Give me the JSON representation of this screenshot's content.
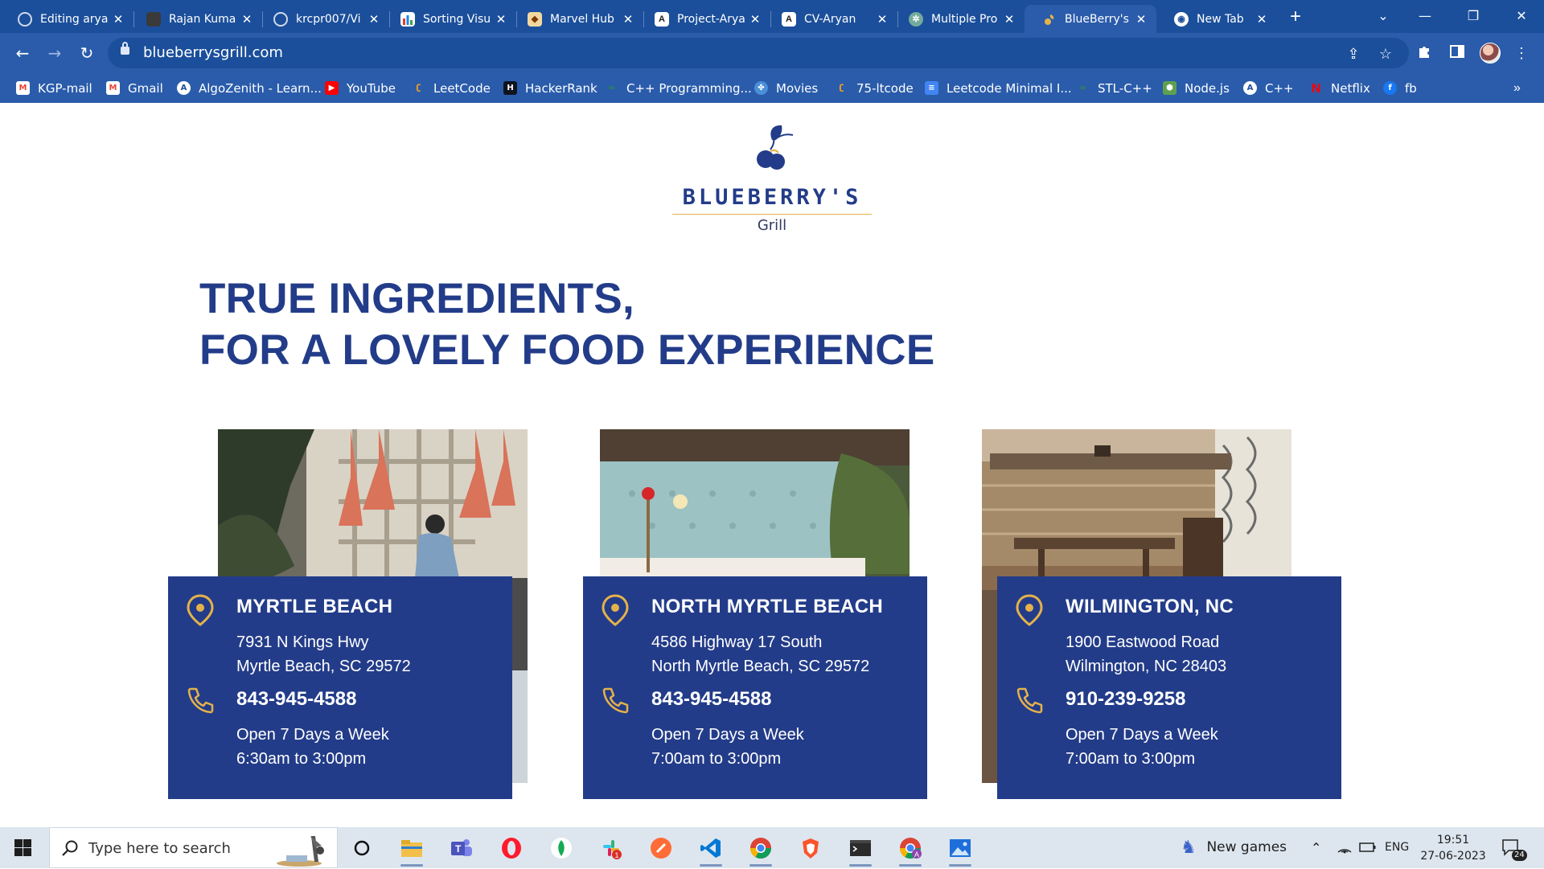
{
  "browser": {
    "tabs": [
      {
        "title": "Editing arya",
        "icon": "github-icon",
        "active": false
      },
      {
        "title": "Rajan Kuma",
        "icon": "profile-photo-icon",
        "active": false
      },
      {
        "title": "krcpr007/Vi",
        "icon": "github-icon",
        "active": false
      },
      {
        "title": "Sorting Visu",
        "icon": "bar-chart-icon",
        "active": false
      },
      {
        "title": "Marvel Hub",
        "icon": "marvel-icon",
        "active": false
      },
      {
        "title": "Project-Arya",
        "icon": "a-letter-icon",
        "active": false
      },
      {
        "title": "CV-Aryan",
        "icon": "a-letter-icon",
        "active": false
      },
      {
        "title": "Multiple Pro",
        "icon": "chatgpt-icon",
        "active": false
      },
      {
        "title": "BlueBerry's",
        "icon": "blueberry-icon",
        "active": true
      },
      {
        "title": "New Tab",
        "icon": "globe-icon",
        "active": false
      }
    ],
    "url": "blueberrysgrill.com",
    "bookmarks": [
      {
        "label": "KGP-mail",
        "icon": "gmail-icon"
      },
      {
        "label": "Gmail",
        "icon": "gmail-icon"
      },
      {
        "label": "AlgoZenith - Learn...",
        "icon": "algozenith-icon"
      },
      {
        "label": "YouTube",
        "icon": "youtube-icon"
      },
      {
        "label": "LeetCode",
        "icon": "leetcode-icon"
      },
      {
        "label": "HackerRank",
        "icon": "hackerrank-icon"
      },
      {
        "label": "C++ Programming...",
        "icon": "gfg-icon"
      },
      {
        "label": "Movies",
        "icon": "film-reel-icon"
      },
      {
        "label": "75-ltcode",
        "icon": "leetcode-icon"
      },
      {
        "label": "Leetcode Minimal I...",
        "icon": "google-docs-icon"
      },
      {
        "label": "STL-C++",
        "icon": "gfg-icon"
      },
      {
        "label": "Node.js",
        "icon": "nodejs-icon"
      },
      {
        "label": "C++",
        "icon": "algozenith-icon"
      },
      {
        "label": "Netflix",
        "icon": "netflix-icon"
      },
      {
        "label": "fb",
        "icon": "facebook-icon"
      }
    ],
    "bookmarks_more": "»"
  },
  "page": {
    "brand": {
      "name": "BLUEBERRY'S",
      "sub": "Grill"
    },
    "headline": {
      "line1": "TRUE INGREDIENTS,",
      "line2": "FOR A LOVELY FOOD EXPERIENCE"
    },
    "locations": [
      {
        "name": "MYRTLE BEACH",
        "address1": "7931 N Kings Hwy",
        "address2": "Myrtle Beach, SC 29572",
        "phone": "843-945-4588",
        "days": "Open 7 Days a Week",
        "hours": "6:30am to 3:00pm"
      },
      {
        "name": "NORTH MYRTLE BEACH",
        "address1": "4586 Highway 17 South",
        "address2": "North Myrtle Beach, SC 29572",
        "phone": "843-945-4588",
        "days": "Open 7 Days a Week",
        "hours": "7:00am to 3:00pm"
      },
      {
        "name": "WILMINGTON, NC",
        "address1": "1900 Eastwood Road",
        "address2": "Wilmington, NC 28403",
        "phone": "910-239-9258",
        "days": "Open 7 Days a Week",
        "hours": "7:00am to 3:00pm"
      }
    ],
    "colors": {
      "brand_navy": "#233c89",
      "accent_gold": "#e4b24b",
      "chrome_blue": "#2a5cab"
    }
  },
  "taskbar": {
    "search_placeholder": "Type here to search",
    "apps": [
      "cortana-icon",
      "file-explorer-icon",
      "teams-icon",
      "opera-icon",
      "mongodb-compass-icon",
      "slack-icon",
      "postman-icon",
      "vscode-icon",
      "chrome-icon",
      "brave-icon",
      "terminal-icon",
      "chrome-profile-icon",
      "photos-icon"
    ],
    "widget": "New games",
    "lang": "ENG",
    "time": "19:51",
    "date": "27-06-2023",
    "notifications": "24"
  }
}
